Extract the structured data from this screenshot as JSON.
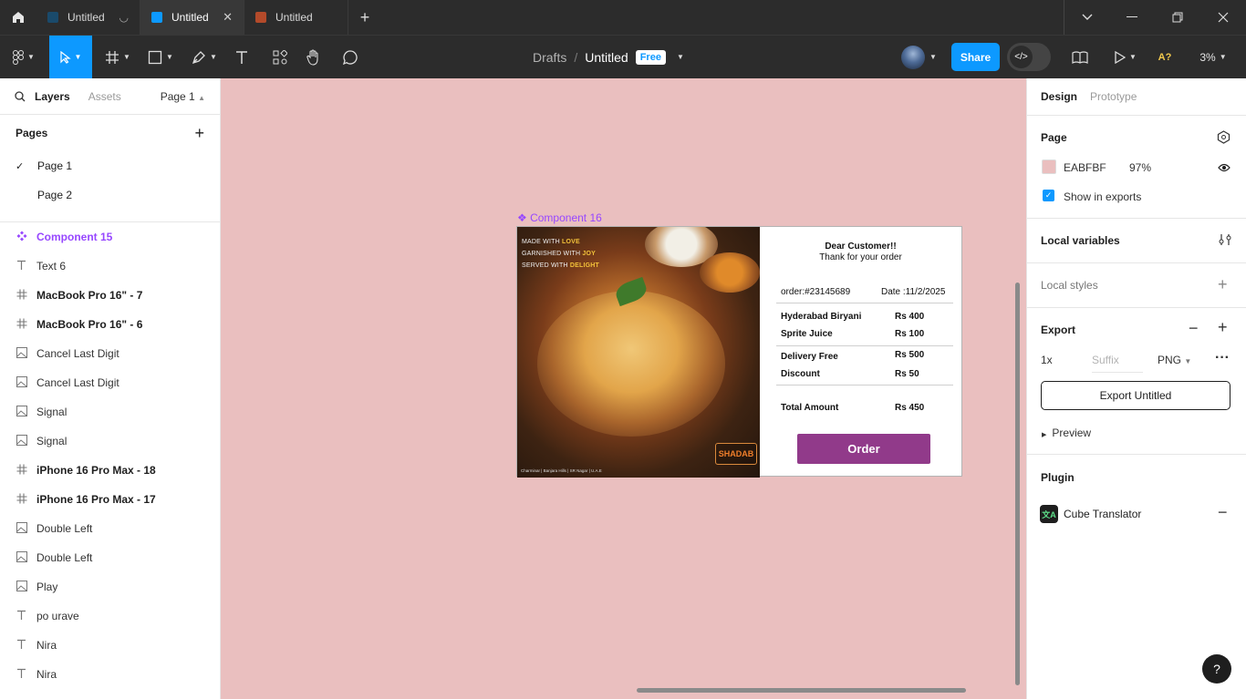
{
  "tabs": [
    {
      "label": "Untitled",
      "icon_color": "#1a4a6b",
      "active": false
    },
    {
      "label": "Untitled",
      "icon_color": "#0d99ff",
      "active": true,
      "close": "✕"
    },
    {
      "label": "Untitled",
      "icon_color": "#b34a2a",
      "active": false
    }
  ],
  "breadcrumb": {
    "drafts": "Drafts",
    "separator": "/",
    "file": "Untitled",
    "badge": "Free"
  },
  "toolbar": {
    "share_label": "Share",
    "zoom": "3%",
    "ai_label": "A?"
  },
  "left_panel": {
    "tab_layers": "Layers",
    "tab_assets": "Assets",
    "page_selector": "Page 1",
    "pages_heading": "Pages",
    "pages": [
      {
        "name": "Page 1",
        "checked": "✓"
      },
      {
        "name": "Page 2",
        "checked": ""
      }
    ],
    "layers": [
      {
        "icon": "component-icon",
        "name": "Component 15",
        "kind": "comp"
      },
      {
        "icon": "text-icon",
        "name": "Text 6",
        "kind": "normal"
      },
      {
        "icon": "frame-icon",
        "name": "MacBook Pro 16\" - 7",
        "kind": "bold"
      },
      {
        "icon": "frame-icon",
        "name": "MacBook Pro 16\" - 6",
        "kind": "bold"
      },
      {
        "icon": "image-icon",
        "name": "Cancel Last Digit",
        "kind": "normal"
      },
      {
        "icon": "image-icon",
        "name": "Cancel Last Digit",
        "kind": "normal"
      },
      {
        "icon": "image-icon",
        "name": "Signal",
        "kind": "normal"
      },
      {
        "icon": "image-icon",
        "name": "Signal",
        "kind": "normal"
      },
      {
        "icon": "frame-icon",
        "name": "iPhone 16 Pro Max - 18",
        "kind": "bold"
      },
      {
        "icon": "frame-icon",
        "name": "iPhone 16 Pro Max - 17",
        "kind": "bold"
      },
      {
        "icon": "image-icon",
        "name": "Double Left",
        "kind": "normal"
      },
      {
        "icon": "image-icon",
        "name": "Double Left",
        "kind": "normal"
      },
      {
        "icon": "image-icon",
        "name": "Play",
        "kind": "normal"
      },
      {
        "icon": "text-icon",
        "name": "po urave",
        "kind": "normal"
      },
      {
        "icon": "text-icon",
        "name": "Nira",
        "kind": "normal"
      },
      {
        "icon": "text-icon",
        "name": "Nira",
        "kind": "normal"
      }
    ]
  },
  "canvas": {
    "background": "#EABFBF",
    "component_label": "❖ Component 16",
    "receipt": {
      "tagline1_a": "MADE WITH ",
      "tagline1_b": "LOVE",
      "tagline2_a": "GARNISHED WITH ",
      "tagline2_b": "JOY",
      "tagline3_a": "SERVED WITH ",
      "tagline3_b": "DELIGHT",
      "footer": "Charminar | Banjara Hills | SR Nagar | U.A.E",
      "logo": "SHADAB",
      "greeting": "Dear Customer!!",
      "thanks": "Thank for your  order",
      "order_no": "order:#23145689",
      "date": "Date :11/2/2025",
      "items": [
        {
          "name": "Hyderabad Biryani",
          "price": "Rs 400"
        },
        {
          "name": "Sprite  Juice",
          "price": "Rs 100"
        }
      ],
      "delivery_label": "Delivery Free",
      "delivery_value": "Rs 500",
      "discount_label": "Discount",
      "discount_value": "Rs 50",
      "total_label": "Total Amount",
      "total_value": "Rs  450",
      "order_button": "Order"
    }
  },
  "right_panel": {
    "tab_design": "Design",
    "tab_prototype": "Prototype",
    "page_heading": "Page",
    "page_color_hex": "EABFBF",
    "page_opacity": "97%",
    "show_in_exports": "Show in exports",
    "local_variables": "Local variables",
    "local_styles": "Local styles",
    "export_heading": "Export",
    "export_scale": "1x",
    "export_suffix_placeholder": "Suffix",
    "export_format": "PNG",
    "export_button": "Export Untitled",
    "preview_label": "Preview",
    "plugin_heading": "Plugin",
    "plugin_name": "Cube Translator",
    "help": "?"
  }
}
